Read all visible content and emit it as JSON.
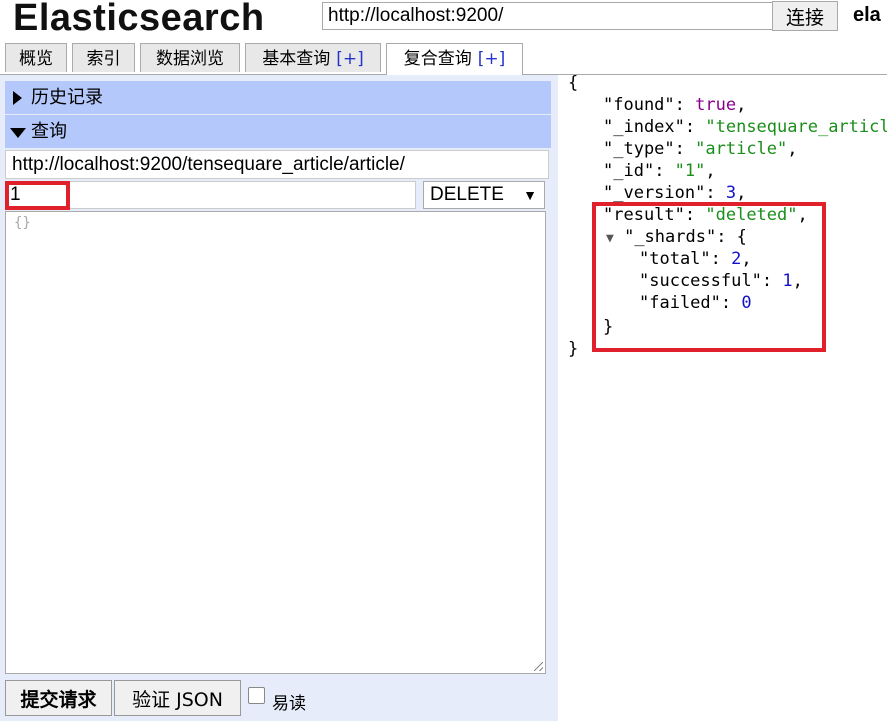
{
  "header": {
    "app_title": "Elasticsearch",
    "server_url": "http://localhost:9200/",
    "connect_label": "连接",
    "cluster_name": "ela"
  },
  "tabs": [
    {
      "label": "概览",
      "plus": ""
    },
    {
      "label": "索引",
      "plus": ""
    },
    {
      "label": "数据浏览",
      "plus": ""
    },
    {
      "label": "基本查询",
      "plus": "[+]"
    },
    {
      "label": "复合查询",
      "plus": "[+]"
    }
  ],
  "active_tab": "复合查询",
  "query_panel": {
    "history_label": "历史记录",
    "query_label": "查询",
    "url": "http://localhost:9200/tensequare_article/article/",
    "path": "1",
    "method": "DELETE",
    "body": "{}",
    "submit_label": "提交请求",
    "validate_label": "验证 JSON",
    "pretty_label": "易读",
    "pretty_checked": false
  },
  "response": {
    "open_brace": "{",
    "close_brace": "}",
    "found_key": "\"found\"",
    "found_val": "true",
    "index_key": "\"_index\"",
    "index_val": "\"tensequare_article\"",
    "type_key": "\"_type\"",
    "type_val": "\"article\"",
    "id_key": "\"_id\"",
    "id_val": "\"1\"",
    "version_key": "\"_version\"",
    "version_val": "3",
    "result_key": "\"result\"",
    "result_val": "\"deleted\"",
    "shards_key": "\"_shards\"",
    "total_key": "\"total\"",
    "total_val": "2",
    "successful_key": "\"successful\"",
    "successful_val": "1",
    "failed_key": "\"failed\"",
    "failed_val": "0"
  },
  "colors": {
    "panel_bg": "#e6ecf9",
    "section_header_bg": "#b4c8fb",
    "highlight_red": "#e0202b",
    "json_string": "#1b8e1b",
    "json_number": "#1212c8",
    "json_bool": "#8b008b"
  }
}
